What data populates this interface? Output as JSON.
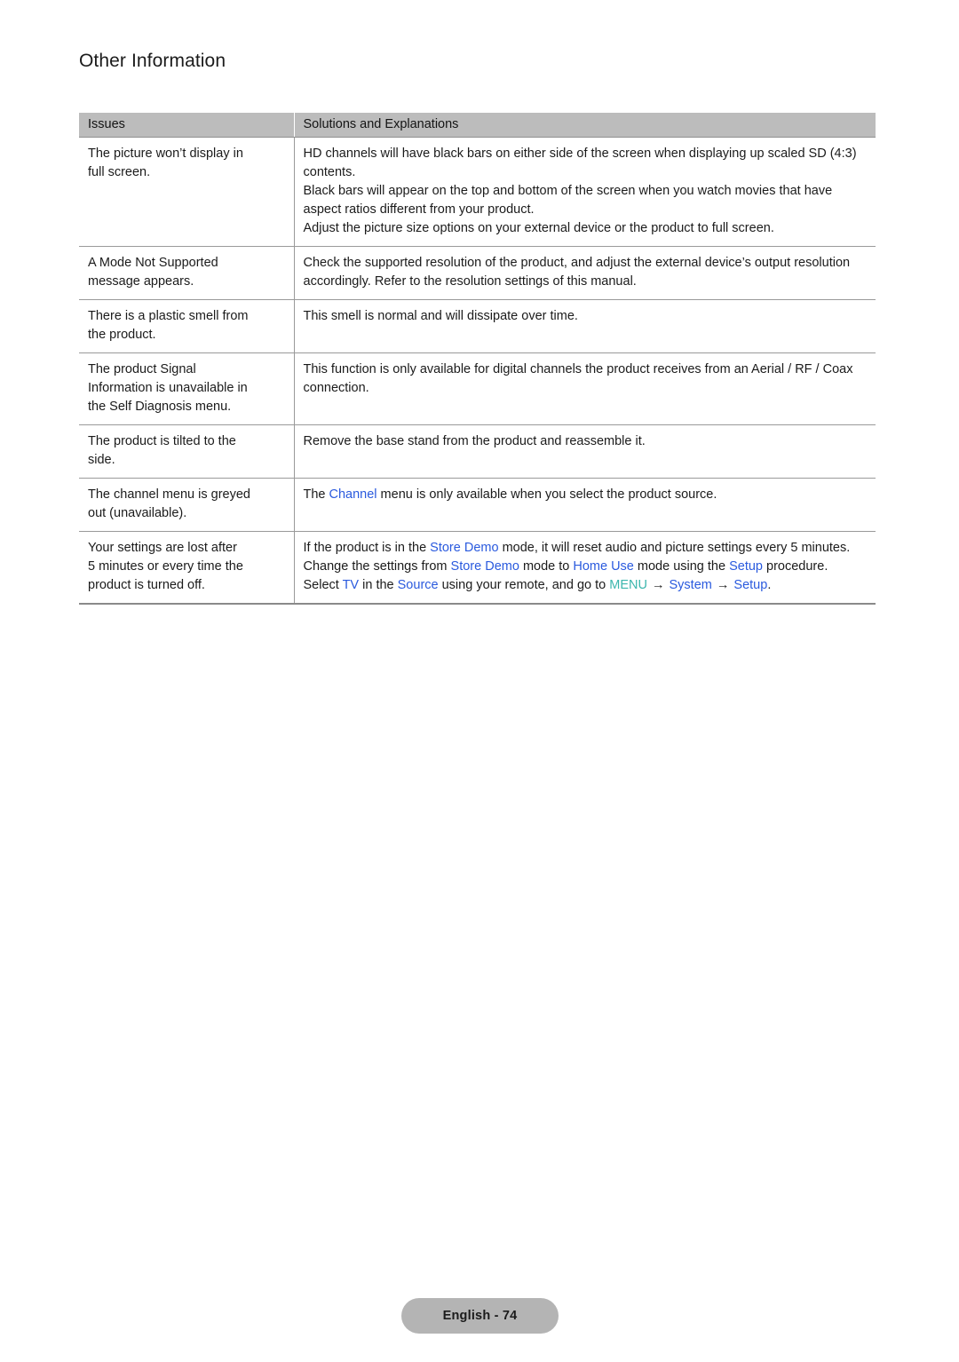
{
  "document": {
    "title": "Other Information"
  },
  "table": {
    "headers": {
      "issues": "Issues",
      "solutions": "Solutions and Explanations"
    },
    "rows": [
      {
        "issue_lines": [
          "The picture won’t display in",
          "full screen."
        ],
        "issue": "The picture won’t display in full screen.",
        "solution_paragraphs": [
          "HD channels will have black bars on either side of the screen when displaying up scaled SD (4:3) contents.",
          "Black bars will appear on the top and bottom of the screen when you watch movies that have aspect ratios different from your product.",
          "Adjust the picture size options on your external device or the product to full screen."
        ]
      },
      {
        "issue_lines": [
          "A Mode Not Supported",
          "message appears."
        ],
        "issue": "A Mode Not Supported message appears.",
        "solution_paragraphs": [
          "Check the supported resolution of the product, and adjust the external device’s output resolution accordingly. Refer to the resolution settings of this manual."
        ]
      },
      {
        "issue_lines": [
          "There is a plastic smell from",
          "the product."
        ],
        "issue": "There is a plastic smell from the product.",
        "solution_paragraphs": [
          "This smell is normal and will dissipate over time."
        ]
      },
      {
        "issue_lines": [
          "The product Signal",
          "Information is unavailable in",
          "the Self Diagnosis menu."
        ],
        "issue": "The product Signal Information is unavailable in the Self Diagnosis menu.",
        "solution_paragraphs": [
          "This function is only available for digital channels the product receives from an Aerial / RF / Coax connection."
        ]
      },
      {
        "issue_lines": [
          "The product is tilted to the",
          "side."
        ],
        "issue": "The product is tilted to the side.",
        "solution_paragraphs": [
          "Remove the base stand from the product and reassemble it."
        ]
      },
      {
        "issue_lines": [
          "The channel menu is greyed",
          "out (unavailable)."
        ],
        "issue": "The channel menu is greyed out (unavailable).",
        "solution_rich": [
          [
            {
              "t": "The ",
              "s": "plain"
            },
            {
              "t": "Channel",
              "s": "blue"
            },
            {
              "t": " menu is only available when you select the product source.",
              "s": "plain"
            }
          ]
        ]
      },
      {
        "issue_lines": [
          "Your settings are lost after",
          "5 minutes or every time the",
          "product is turned off."
        ],
        "issue": "Your settings are lost after 5 minutes or every time the product is turned off.",
        "solution_rich": [
          [
            {
              "t": "If the product is in the ",
              "s": "plain"
            },
            {
              "t": "Store Demo",
              "s": "blue"
            },
            {
              "t": " mode, it will reset audio and picture settings every 5 minutes. Change the settings from ",
              "s": "plain"
            },
            {
              "t": "Store Demo",
              "s": "blue"
            },
            {
              "t": " mode to ",
              "s": "plain"
            },
            {
              "t": "Home Use",
              "s": "blue"
            },
            {
              "t": " mode using the ",
              "s": "plain"
            },
            {
              "t": "Setup",
              "s": "blue"
            },
            {
              "t": " procedure. Select ",
              "s": "plain"
            },
            {
              "t": "TV",
              "s": "blue"
            },
            {
              "t": " in the ",
              "s": "plain"
            },
            {
              "t": "Source",
              "s": "blue"
            },
            {
              "t": " using your remote, and go to ",
              "s": "plain"
            },
            {
              "t": "MENU",
              "s": "teal"
            },
            {
              "t": " → ",
              "s": "arrow"
            },
            {
              "t": "System",
              "s": "blue"
            },
            {
              "t": " → ",
              "s": "arrow"
            },
            {
              "t": "Setup",
              "s": "blue"
            },
            {
              "t": ".",
              "s": "plain"
            }
          ]
        ]
      }
    ]
  },
  "footer": {
    "label": "English - 74"
  },
  "colors": {
    "highlight_blue": "#2a5ade",
    "highlight_teal": "#3cb6ad",
    "header_gray": "#bcbcbc",
    "pill_gray": "#b4b4b4",
    "rule_gray": "#9a9a9a",
    "text": "#1b1b1b"
  }
}
